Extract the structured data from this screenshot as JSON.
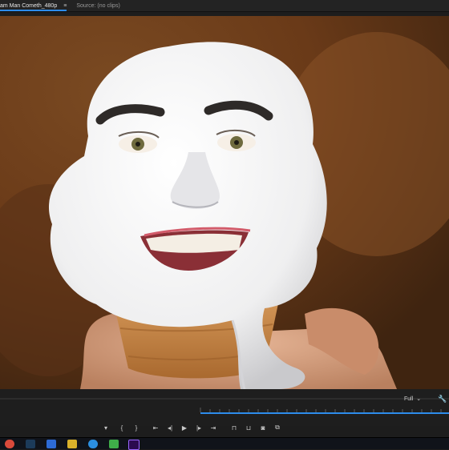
{
  "tabs": {
    "active_label": "am Man Cometh_480p",
    "source_label": "Source: (no clips)"
  },
  "viewer": {
    "zoom_value": "Full"
  },
  "icons": {
    "menu": "hamburger-icon",
    "settings": "wrench-icon",
    "zoom_dropdown": "chevron-down-icon"
  },
  "transport": [
    "add-marker",
    "mark-in",
    "mark-out",
    "go-to-in",
    "step-back",
    "play",
    "step-forward",
    "go-to-out",
    "insert",
    "overwrite",
    "export-frame",
    "compare"
  ],
  "taskbar": [
    "chrome",
    "steam",
    "app",
    "app",
    "edge",
    "app",
    "premiere"
  ],
  "colors": {
    "accent": "#2d8ceb",
    "premiere": "#2b0b4f"
  }
}
